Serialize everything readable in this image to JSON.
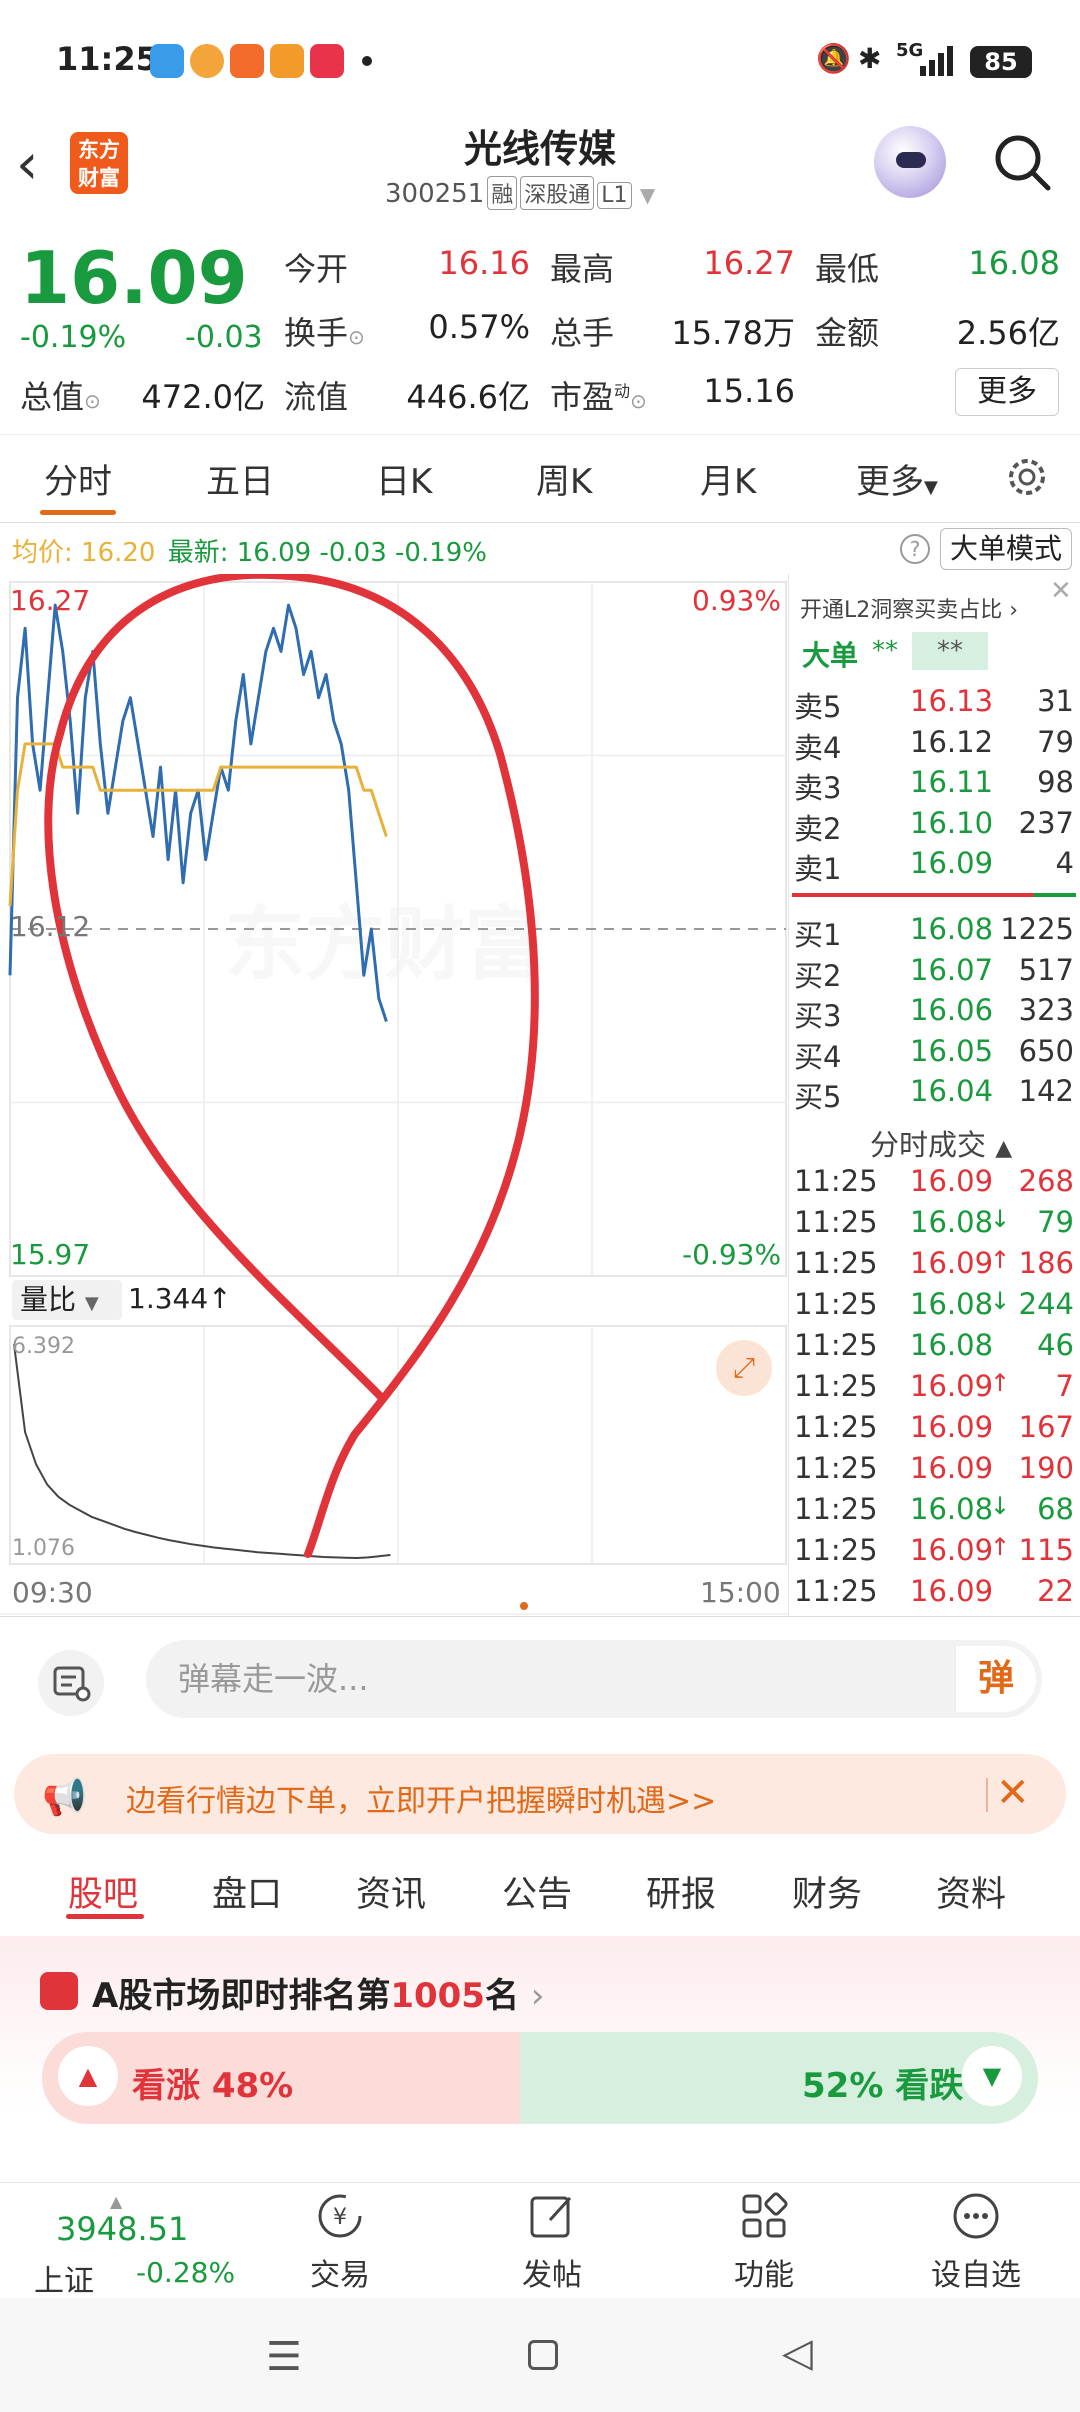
{
  "status_bar": {
    "time": "11:25",
    "network": "5G",
    "battery": "85"
  },
  "header": {
    "logo_text_line1": "东方",
    "logo_text_line2": "财富",
    "stock_name": "光线传媒",
    "stock_code": "300251",
    "tags": [
      "融",
      "深股通",
      "L1"
    ]
  },
  "quote": {
    "price": "16.09",
    "change_pct": "-0.19%",
    "change_abs": "-0.03",
    "fields": [
      {
        "label": "今开",
        "value": "16.16",
        "color": "red"
      },
      {
        "label": "最高",
        "value": "16.27",
        "color": "red"
      },
      {
        "label": "最低",
        "value": "16.08",
        "color": "green"
      },
      {
        "label": "换手",
        "value": "0.57%",
        "color": "black"
      },
      {
        "label": "总手",
        "value": "15.78万",
        "color": "black"
      },
      {
        "label": "金额",
        "value": "2.56亿",
        "color": "black"
      },
      {
        "label": "总值",
        "value": "472.0亿",
        "color": "black"
      },
      {
        "label": "流值",
        "value": "446.6亿",
        "color": "black"
      },
      {
        "label": "市盈",
        "value": "15.16",
        "color": "black"
      }
    ],
    "pe_superscript": "动",
    "more_label": "更多"
  },
  "chart_tabs": [
    "分时",
    "五日",
    "日K",
    "周K",
    "月K",
    "更多"
  ],
  "avg_row": {
    "avg_label": "均价:",
    "avg_value": "16.20",
    "latest_label": "最新:",
    "latest_value": "16.09",
    "latest_change": "-0.03",
    "latest_pct": "-0.19%",
    "bigmode_label": "大单模式"
  },
  "chart_labels": {
    "high": "16.27",
    "high_pct": "0.93%",
    "mid": "16.12",
    "low": "15.97",
    "low_pct": "-0.93%",
    "watermark": "东方财富",
    "vol_selector": "量比",
    "vol_value": "1.344",
    "vol_max": "6.392",
    "vol_min": "1.076",
    "time_start": "09:30",
    "time_end": "15:00"
  },
  "chart_data": {
    "type": "line",
    "title": "",
    "xlabel": "",
    "ylabel": "",
    "x_range": [
      "09:30",
      "15:00"
    ],
    "ylim": [
      15.97,
      16.27
    ],
    "reference_price": 16.12,
    "series": [
      {
        "values": [
          16.1,
          16.22,
          16.25,
          16.2,
          16.18,
          16.22,
          16.26,
          16.24,
          16.21,
          16.17,
          16.22,
          16.24,
          16.2,
          16.17,
          16.19,
          16.21,
          16.22,
          16.2,
          16.18,
          16.16,
          16.19,
          16.15,
          16.18,
          16.14,
          16.17,
          16.18,
          16.15,
          16.17,
          16.19,
          16.18,
          16.21,
          16.23,
          16.2,
          16.22,
          16.24,
          16.25,
          16.24,
          16.26,
          16.25,
          16.23,
          16.24,
          16.22,
          16.23,
          16.21,
          16.2,
          16.18,
          16.14,
          16.1,
          16.12,
          16.09,
          16.08
        ]
      },
      {
        "values": [
          16.13,
          16.18,
          16.2,
          16.2,
          16.2,
          16.2,
          16.2,
          16.19,
          16.19,
          16.19,
          16.19,
          16.19,
          16.18,
          16.18,
          16.18,
          16.18,
          16.18,
          16.18,
          16.18,
          16.18,
          16.18,
          16.18,
          16.18,
          16.18,
          16.18,
          16.18,
          16.18,
          16.18,
          16.19,
          16.19,
          16.19,
          16.19,
          16.19,
          16.19,
          16.19,
          16.19,
          16.19,
          16.19,
          16.19,
          16.19,
          16.19,
          16.19,
          16.19,
          16.19,
          16.19,
          16.19,
          16.19,
          16.18,
          16.18,
          16.17,
          16.16
        ]
      }
    ],
    "volume_ratio": {
      "ylim": [
        1.076,
        6.392
      ],
      "values": [
        6.392,
        4.2,
        3.4,
        2.9,
        2.6,
        2.4,
        2.25,
        2.1,
        2.0,
        1.9,
        1.8,
        1.72,
        1.65,
        1.58,
        1.52,
        1.47,
        1.42,
        1.38,
        1.34,
        1.31,
        1.28,
        1.25,
        1.22,
        1.2,
        1.18,
        1.16,
        1.14,
        1.12,
        1.1,
        1.09,
        1.08,
        1.076,
        1.09,
        1.12,
        1.15
      ]
    },
    "grid": true
  },
  "right_panel": {
    "l2_banner": "开通L2洞察买卖占比",
    "bigorder_label": "大单",
    "bigorder_v1": "**",
    "bigorder_v2": "**",
    "asks": [
      {
        "label": "卖5",
        "price": "16.13",
        "vol": "31",
        "color": "red"
      },
      {
        "label": "卖4",
        "price": "16.12",
        "vol": "79",
        "color": "black"
      },
      {
        "label": "卖3",
        "price": "16.11",
        "vol": "98",
        "color": "green"
      },
      {
        "label": "卖2",
        "price": "16.10",
        "vol": "237",
        "color": "green"
      },
      {
        "label": "卖1",
        "price": "16.09",
        "vol": "4",
        "color": "green"
      }
    ],
    "bids": [
      {
        "label": "买1",
        "price": "16.08",
        "vol": "1225",
        "color": "green"
      },
      {
        "label": "买2",
        "price": "16.07",
        "vol": "517",
        "color": "green"
      },
      {
        "label": "买3",
        "price": "16.06",
        "vol": "323",
        "color": "green"
      },
      {
        "label": "买4",
        "price": "16.05",
        "vol": "650",
        "color": "green"
      },
      {
        "label": "买5",
        "price": "16.04",
        "vol": "142",
        "color": "green"
      }
    ],
    "ticks_title": "分时成交",
    "ticks": [
      {
        "time": "11:25",
        "price": "16.09",
        "arrow": "",
        "vol": "268",
        "color": "red"
      },
      {
        "time": "11:25",
        "price": "16.08",
        "arrow": "↓",
        "vol": "79",
        "color": "green"
      },
      {
        "time": "11:25",
        "price": "16.09",
        "arrow": "↑",
        "vol": "186",
        "color": "red"
      },
      {
        "time": "11:25",
        "price": "16.08",
        "arrow": "↓",
        "vol": "244",
        "color": "green"
      },
      {
        "time": "11:25",
        "price": "16.08",
        "arrow": "",
        "vol": "46",
        "color": "green"
      },
      {
        "time": "11:25",
        "price": "16.09",
        "arrow": "↑",
        "vol": "7",
        "color": "red"
      },
      {
        "time": "11:25",
        "price": "16.09",
        "arrow": "",
        "vol": "167",
        "color": "red"
      },
      {
        "time": "11:25",
        "price": "16.09",
        "arrow": "",
        "vol": "190",
        "color": "red"
      },
      {
        "time": "11:25",
        "price": "16.08",
        "arrow": "↓",
        "vol": "68",
        "color": "green"
      },
      {
        "time": "11:25",
        "price": "16.09",
        "arrow": "↑",
        "vol": "115",
        "color": "red"
      },
      {
        "time": "11:25",
        "price": "16.09",
        "arrow": "",
        "vol": "22",
        "color": "red"
      }
    ]
  },
  "danmaku": {
    "placeholder": "弹幕走一波...",
    "send_label": "弹"
  },
  "promo": {
    "text": "边看行情边下单，立即开户把握瞬时机遇>>"
  },
  "bottom_tabs": [
    "股吧",
    "盘口",
    "资讯",
    "公告",
    "研报",
    "财务",
    "资料"
  ],
  "ranking": {
    "prefix": "A股市场即时排名第",
    "rank": "1005",
    "suffix": "名"
  },
  "sentiment": {
    "bull_label": "看涨 48%",
    "bear_label": "52% 看跌",
    "bull_fraction": 0.48
  },
  "bottom_nav": {
    "index_value": "3948.51",
    "index_name": "上证",
    "index_change": "-0.28%",
    "items": [
      "交易",
      "发帖",
      "功能",
      "设自选"
    ]
  },
  "colors": {
    "up": "#e0343a",
    "down": "#1a9a3e",
    "accent": "#e06a1a",
    "avg_line": "#e8b13a",
    "price_line": "#2f6cb0",
    "annotation": "#e0343a"
  }
}
